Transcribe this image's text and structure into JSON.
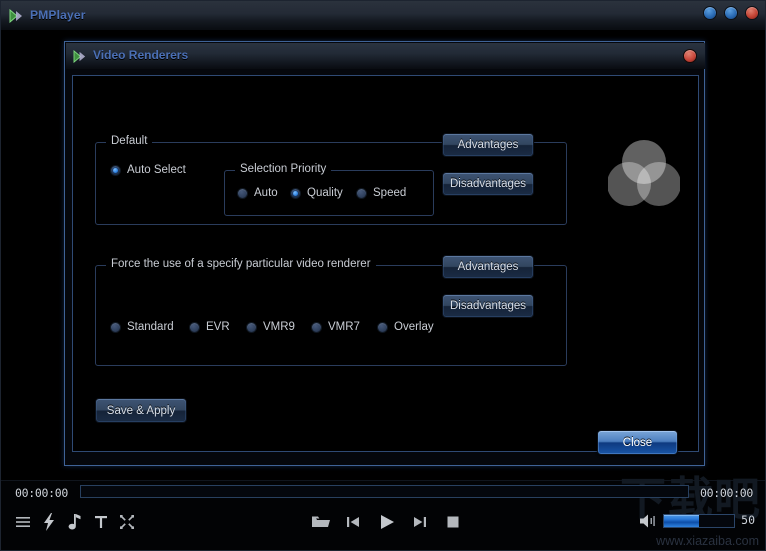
{
  "app": {
    "title": "PMPlayer",
    "logo_icon": "play-triangle-logo-icon",
    "window_buttons": [
      {
        "name": "minimize-button",
        "color": "#2a6bb5"
      },
      {
        "name": "maximize-button",
        "color": "#2a6bb5"
      },
      {
        "name": "close-button",
        "color": "#c24233"
      }
    ]
  },
  "dialog": {
    "title": "Video Renderers",
    "logo_icon": "play-triangle-logo-icon",
    "close_icon": "close-circle-icon",
    "groups": {
      "default": {
        "title": "Default",
        "auto_select": {
          "label": "Auto Select",
          "checked": true
        },
        "selection_priority": {
          "title": "Selection Priority",
          "options": [
            {
              "label": "Auto",
              "checked": false
            },
            {
              "label": "Quality",
              "checked": true
            },
            {
              "label": "Speed",
              "checked": false
            }
          ]
        },
        "advantages_label": "Advantages",
        "disadvantages_label": "Disadvantages"
      },
      "force": {
        "title": "Force the use of a specify particular video renderer",
        "options": [
          {
            "label": "Standard",
            "checked": false
          },
          {
            "label": "EVR",
            "checked": false
          },
          {
            "label": "VMR9",
            "checked": false
          },
          {
            "label": "VMR7",
            "checked": false
          },
          {
            "label": "Overlay",
            "checked": false
          }
        ],
        "advantages_label": "Advantages",
        "disadvantages_label": "Disadvantages"
      }
    },
    "save_apply_label": "Save & Apply",
    "close_label": "Close",
    "renderer_logo_icon": "three-overlapping-circles-icon"
  },
  "player": {
    "time_current": "00:00:00",
    "time_total": "00:00:00",
    "seek_position_percent": 0,
    "volume_value": "50",
    "volume_percent": 50,
    "left_icons": [
      {
        "name": "menu-icon",
        "title": "Menu"
      },
      {
        "name": "bolt-icon",
        "title": "Quick settings"
      },
      {
        "name": "music-note-icon",
        "title": "Audio"
      },
      {
        "name": "subtitle-icon",
        "title": "Subtitles"
      },
      {
        "name": "shuffle-icon",
        "title": "Shuffle"
      }
    ],
    "transport_icons": [
      {
        "name": "open-file-icon",
        "title": "Open"
      },
      {
        "name": "previous-icon",
        "title": "Previous"
      },
      {
        "name": "play-icon",
        "title": "Play"
      },
      {
        "name": "next-icon",
        "title": "Next"
      },
      {
        "name": "stop-icon",
        "title": "Stop"
      }
    ],
    "volume_icon": "speaker-icon"
  },
  "watermark": {
    "cjk": "下载吧",
    "url": "www.xiazaiba.com"
  },
  "colors": {
    "accent_blue": "#4a6fb5",
    "button_highlight": "#4d7fc0",
    "close_red": "#c24233",
    "text": "#c9cdd4"
  }
}
